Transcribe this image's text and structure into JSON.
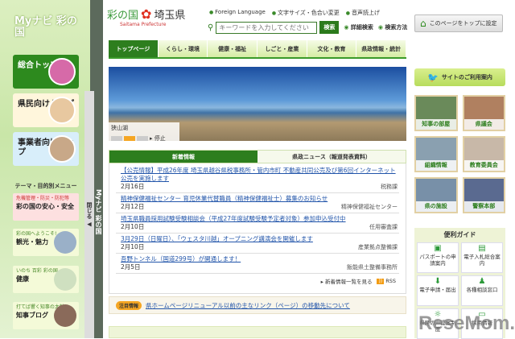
{
  "sidebar": {
    "title": "Myナビ 彩の国",
    "title_ruby": "マイ",
    "main": [
      {
        "label": "総合トップ"
      },
      {
        "label": "県民向けトップ"
      },
      {
        "label": "事業者向けトップ"
      }
    ],
    "theme_heading": "テーマ・目的別メニュー",
    "themes": [
      {
        "sub": "危機管理・防災・防犯等",
        "label": "彩の国の安心・安全"
      },
      {
        "sub": "彩の国へようこそ!",
        "label": "観光・魅力"
      },
      {
        "sub": "いのち 百彩 彩の国",
        "label": "健康"
      },
      {
        "sub": "打てば響く知事の太鼓",
        "label": "知事ブログ"
      }
    ],
    "strip_label": "Myナビ 彩の国",
    "close_label": "閉じる ◀"
  },
  "header": {
    "logo_main": "彩の国",
    "logo_pref": "埼玉県",
    "logo_sub": "Saitama Prefecture",
    "links": [
      "Foreign Language",
      "文字サイズ・色合い変更",
      "音声読上げ"
    ],
    "search_placeholder": "キーワードを入力してください",
    "search_button": "検索",
    "advanced_search": "詳細検索",
    "search_help": "検索方法",
    "set_top": "このページをトップに設定"
  },
  "nav": [
    "トップページ",
    "くらし・環境",
    "健康・福祉",
    "しごと・産業",
    "文化・教育",
    "県政情報・統計"
  ],
  "hero": {
    "caption": "狭山湖",
    "stop": "▸ 停止"
  },
  "tabs": [
    "新着情報",
    "県政ニュース（報道発表資料）"
  ],
  "news": [
    {
      "title": "【公売情報】平成26年度 埼玉県越谷県税事務所・管内市町 不動産共同公売及び第6回インターネット公売を実施します",
      "date": "2月16日",
      "dept": "税務課"
    },
    {
      "title": "精神保健福祉センター 育児休業代替職員（精神保健福祉士）募集のお知らせ",
      "date": "2月12日",
      "dept": "精神保健福祉センター"
    },
    {
      "title": "埼玉県職員採用試験受験相談会（平成27年度試験受験予定者対象）参加申込受付中",
      "date": "2月10日",
      "dept": "任用審査課"
    },
    {
      "title": "3月29日（日曜日）、「ウェスタ川越」オープニング講演会を開催します",
      "date": "2月10日",
      "dept": "産業拠点整備課"
    },
    {
      "title": "吾野トンネル（国道299号）が開通します！",
      "date": "2月5日",
      "dept": "飯能県土整備事務所"
    }
  ],
  "news_more": "▸ 新着情報一覧を見る",
  "rss": "RSS",
  "notice": {
    "badge": "注目情報",
    "text": "県ホームページリニューアル以前の主なリンク（ページ）の移動先について"
  },
  "right": {
    "guide": "サイトのご利用案内",
    "tiles": [
      "知事の部屋",
      "県議会",
      "組織情報",
      "教育委員会",
      "県の施設",
      "警察本部"
    ],
    "benri_title": "便利ガイド",
    "benri": [
      "パスポートの申請案内",
      "電子入札総合案内",
      "電子申請・届出",
      "各種相談窓口",
      "県民の声提案制度",
      "採用情報"
    ]
  },
  "watermark": "ReseMom"
}
